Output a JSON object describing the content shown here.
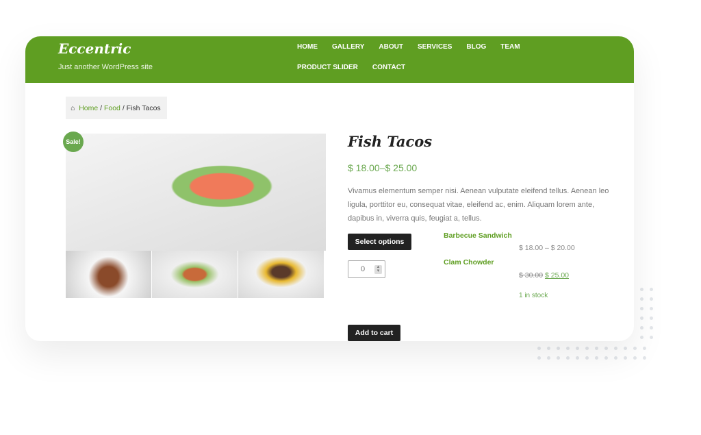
{
  "site": {
    "title": "Eccentric",
    "tagline": "Just another WordPress site"
  },
  "nav": [
    "HOME",
    "GALLERY",
    "ABOUT",
    "SERVICES",
    "BLOG",
    "TEAM",
    "PRODUCT SLIDER",
    "CONTACT"
  ],
  "breadcrumb": {
    "home": "Home",
    "category": "Food",
    "current": "Fish Tacos",
    "sep": "/"
  },
  "product": {
    "badge": "Sale!",
    "title": "Fish Tacos",
    "price": "$ 18.00–$ 25.00",
    "description": "Vivamus elementum semper nisi. Aenean vulputate eleifend tellus. Aenean leo ligula, porttitor eu, consequat vitae, eleifend ac, enim. Aliquam lorem ante, dapibus in, viverra quis, feugiat a, tellus.",
    "select_options": "Select options",
    "quantity": "0",
    "add_to_cart": "Add to cart",
    "grouped": [
      {
        "name": "Barbecue Sandwich",
        "price": "$ 18.00 – $ 20.00"
      },
      {
        "name": "Clam Chowder",
        "old_price": "$ 30.00",
        "sale_price": "$ 25.00",
        "stock": "1 in stock"
      }
    ]
  },
  "colors": {
    "brand": "#5f9e22",
    "price": "#6aa84f",
    "button": "#222222"
  }
}
